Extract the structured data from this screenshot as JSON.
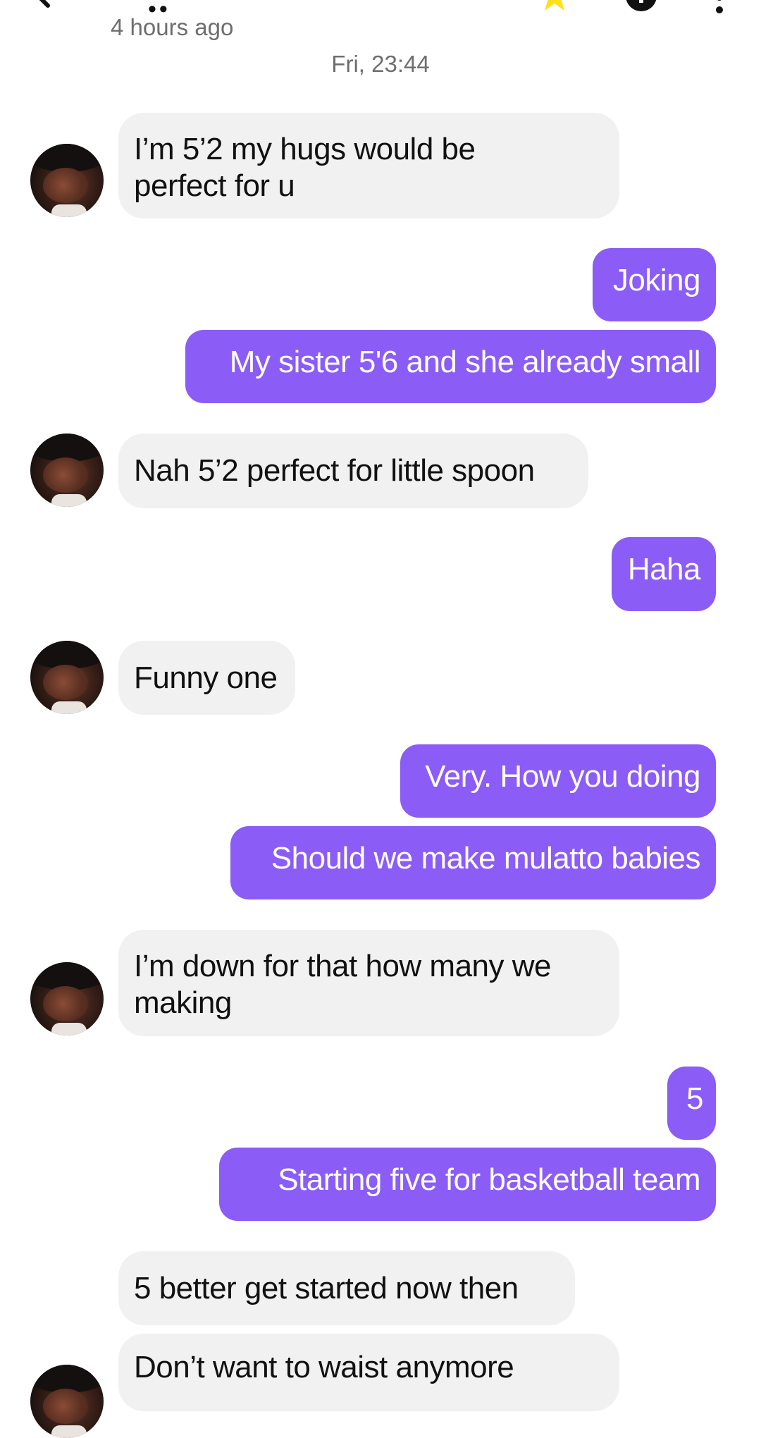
{
  "header": {
    "name_obscured": "••",
    "last_seen": "4 hours ago",
    "star_color": "#ffe01b"
  },
  "date_separator": "Fri, 23:44",
  "messages": [
    {
      "side": "in",
      "text": "I’m 5’2 my hugs would be\nperfect for u",
      "avatar": true
    },
    {
      "side": "out",
      "text": "Joking"
    },
    {
      "side": "out",
      "text": "My sister 5'6 and she already small"
    },
    {
      "side": "in",
      "text": "Nah 5’2 perfect for little spoon",
      "avatar": true
    },
    {
      "side": "out",
      "text": "Haha"
    },
    {
      "side": "in",
      "text": "Funny one",
      "avatar": true
    },
    {
      "side": "out",
      "text": "Very. How you doing"
    },
    {
      "side": "out",
      "text": "Should we make mulatto babies"
    },
    {
      "side": "in",
      "text": "I’m down for that how many we\nmaking",
      "avatar": true
    },
    {
      "side": "out",
      "text": "5"
    },
    {
      "side": "out",
      "text": "Starting five for basketball team"
    },
    {
      "side": "in",
      "text": "5 better get started now then",
      "avatar": false
    },
    {
      "side": "in",
      "text": "Don’t want to waist anymore",
      "avatar": true
    }
  ],
  "colors": {
    "outgoing_bubble": "#8b5cf6",
    "incoming_bubble": "#f1f1f1"
  }
}
